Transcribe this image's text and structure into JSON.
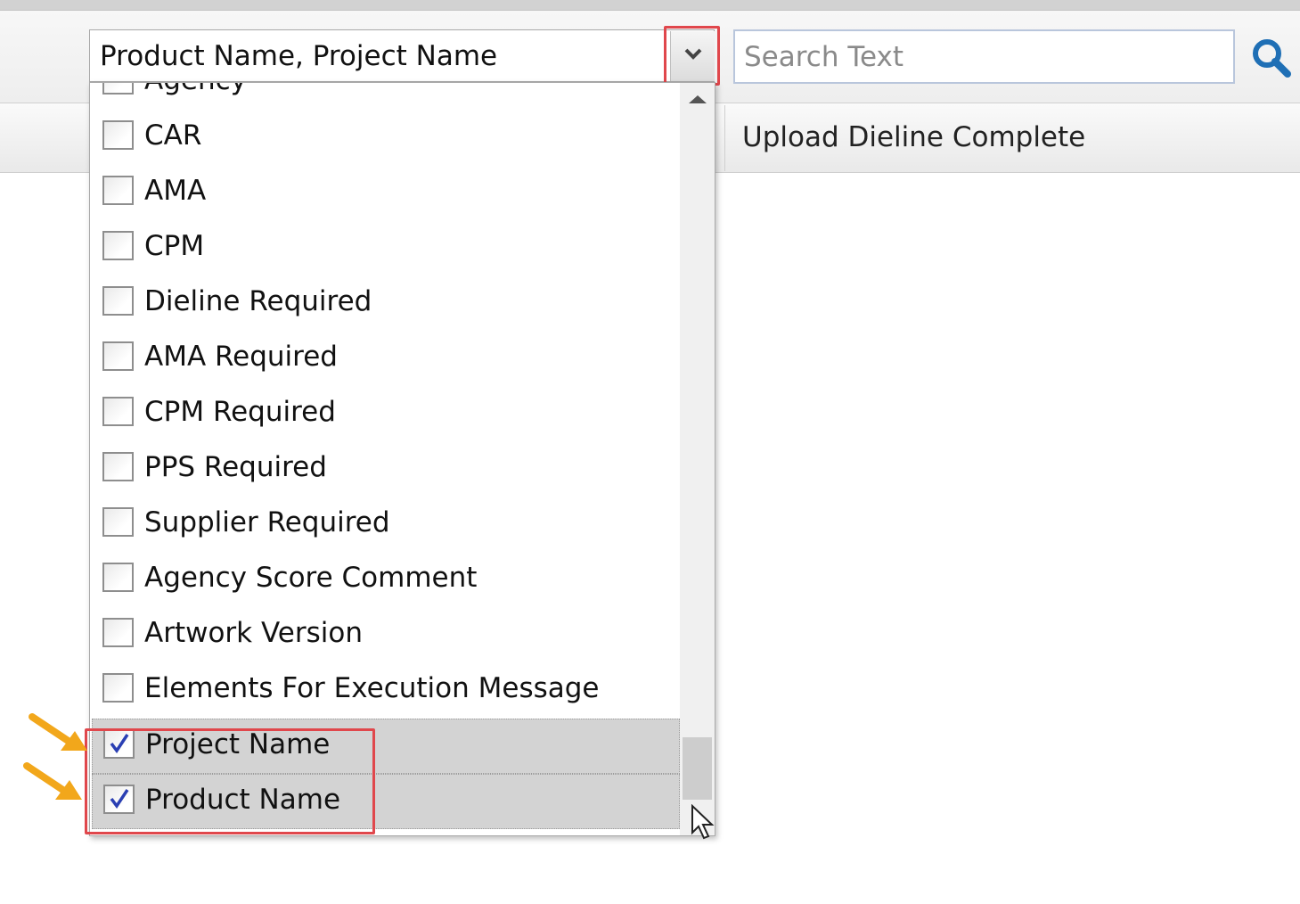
{
  "filter": {
    "selected_value": "Product Name, Project Name",
    "search_placeholder": "Search Text",
    "options": [
      {
        "label": "Agency",
        "checked": false
      },
      {
        "label": "CAR",
        "checked": false
      },
      {
        "label": "AMA",
        "checked": false
      },
      {
        "label": "CPM",
        "checked": false
      },
      {
        "label": "Dieline Required",
        "checked": false
      },
      {
        "label": "AMA Required",
        "checked": false
      },
      {
        "label": "CPM Required",
        "checked": false
      },
      {
        "label": "PPS Required",
        "checked": false
      },
      {
        "label": "Supplier Required",
        "checked": false
      },
      {
        "label": "Agency Score Comment",
        "checked": false
      },
      {
        "label": "Artwork Version",
        "checked": false
      },
      {
        "label": "Elements For Execution Message",
        "checked": false
      },
      {
        "label": "Project Name",
        "checked": true
      },
      {
        "label": "Product Name",
        "checked": true
      }
    ]
  },
  "grid": {
    "column_header": "Upload Dieline Complete"
  },
  "icons": {
    "dropdown_toggle": "chevron-down-icon",
    "search": "search-icon",
    "callout_arrow": "arrow-right-icon",
    "pointer": "mouse-cursor-icon"
  },
  "colors": {
    "highlight_box": "#e0474c",
    "callout_arrow": "#f2a71b",
    "search_icon": "#1f6fb5",
    "checked_row_bg": "#d3d3d3"
  }
}
